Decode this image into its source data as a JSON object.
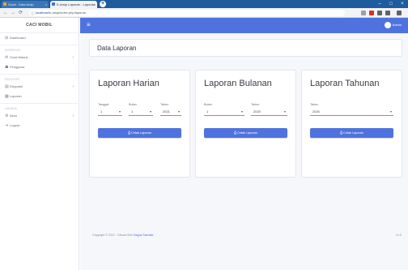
{
  "browser": {
    "tabs": [
      {
        "title": "Surat - Data Arsip",
        "close": "×"
      },
      {
        "title": "E-Arsip Laporan - Laporan",
        "close": "×"
      }
    ],
    "new_tab": "+",
    "window_controls": [
      "–",
      "□",
      "×"
    ],
    "nav": {
      "back": "←",
      "forward": "→",
      "reload": "⟳"
    },
    "url_host": "localhost",
    "url_path": "/e-arsip/index.php/laporan"
  },
  "sidebar": {
    "brand": "CACI MOBIL",
    "items": [
      {
        "section": "",
        "label": "Dashboard",
        "icon": "gauge-icon",
        "glyph": "⊞",
        "chevron": false
      },
      {
        "section": "INTERFACE",
        "label": "Surat Masuk",
        "icon": "envelope-icon",
        "glyph": "✉",
        "chevron": true
      },
      {
        "section": "",
        "label": "Pengguna",
        "icon": "user-icon",
        "glyph": "☗",
        "chevron": false
      },
      {
        "section": "KATEGORI",
        "label": "Disposisi",
        "icon": "folder-icon",
        "glyph": "▤",
        "chevron": true
      },
      {
        "section": "",
        "label": "Laporan",
        "icon": "chart-icon",
        "glyph": "▦",
        "chevron": false
      },
      {
        "section": "LAINNYA",
        "label": "Akun",
        "icon": "cog-icon",
        "glyph": "⚙",
        "chevron": true
      },
      {
        "section": "",
        "label": "Logout",
        "icon": "signout-icon",
        "glyph": "⇥",
        "chevron": false
      }
    ]
  },
  "topbar": {
    "menu_glyph": "≡",
    "user_name": "Admin"
  },
  "page": {
    "title": "Data Laporan"
  },
  "cards": [
    {
      "title": "Laporan Harian",
      "fields": [
        {
          "label": "Tanggal",
          "value": "1"
        },
        {
          "label": "Bulan",
          "value": "1"
        },
        {
          "label": "Tahun",
          "value": "2021"
        }
      ],
      "button": "Cetak Laporan"
    },
    {
      "title": "Laporan Bulanan",
      "fields": [
        {
          "label": "Bulan",
          "value": "1"
        },
        {
          "label": "Tahun",
          "value": "2020"
        }
      ],
      "button": "Cetak Laporan"
    },
    {
      "title": "Laporan Tahunan",
      "fields": [
        {
          "label": "Tahun",
          "value": "2020"
        }
      ],
      "button": "Cetak Laporan"
    }
  ],
  "footer": {
    "text": "Copyright © 2021 · Dibuat Oleh",
    "link": "Bagus Sasmita",
    "version": "v1.0"
  },
  "colors": {
    "primary": "#4e73df",
    "tabbar": "#1f5c9e"
  }
}
